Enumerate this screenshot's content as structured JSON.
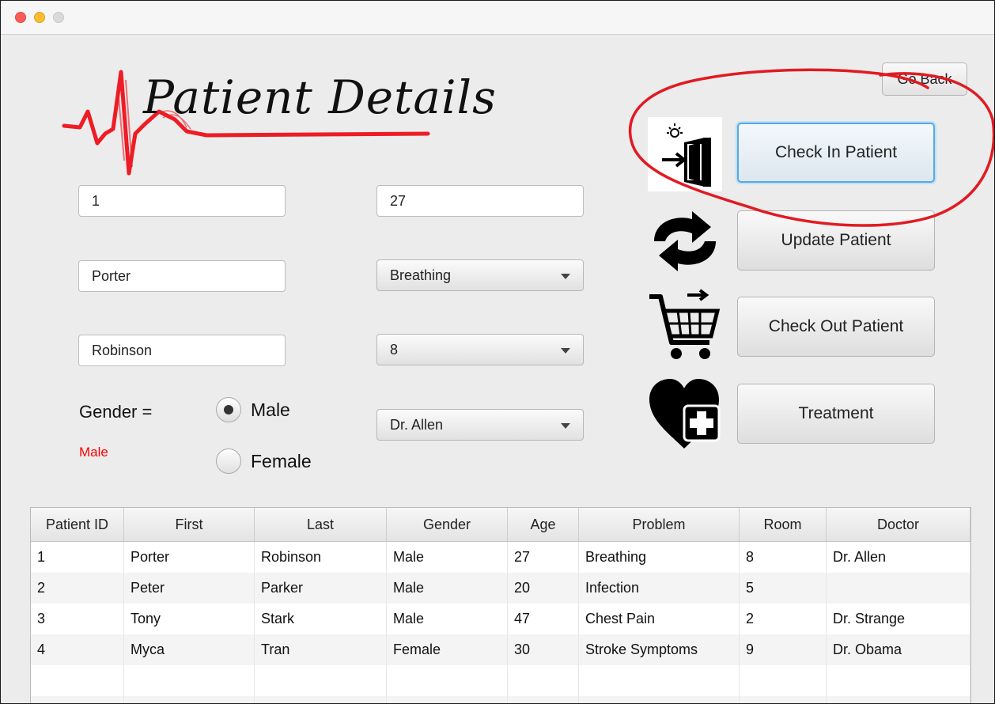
{
  "header": {
    "title": "Patient Details",
    "go_back_label": "Go Back"
  },
  "form": {
    "patient_id": "1",
    "age": "27",
    "first_name": "Porter",
    "problem": "Breathing",
    "last_name": "Robinson",
    "room": "8",
    "gender_label": "Gender =",
    "gender_value": "Male",
    "gender_options": [
      {
        "label": "Male",
        "selected": true
      },
      {
        "label": "Female",
        "selected": false
      }
    ],
    "doctor": "Dr. Allen"
  },
  "actions": [
    {
      "label": "Check In Patient",
      "icon": "check-in-door-icon",
      "focused": true
    },
    {
      "label": "Update Patient",
      "icon": "refresh-arrows-icon",
      "focused": false
    },
    {
      "label": "Check Out Patient",
      "icon": "shopping-cart-icon",
      "focused": false
    },
    {
      "label": "Treatment",
      "icon": "heart-plus-icon",
      "focused": false
    }
  ],
  "table": {
    "columns": [
      "Patient ID",
      "First",
      "Last",
      "Gender",
      "Age",
      "Problem",
      "Room",
      "Doctor"
    ],
    "rows": [
      [
        "1",
        "Porter",
        "Robinson",
        "Male",
        "27",
        "Breathing",
        "8",
        "Dr. Allen"
      ],
      [
        "2",
        "Peter",
        "Parker",
        "Male",
        "20",
        "Infection",
        "5",
        ""
      ],
      [
        "3",
        "Tony",
        "Stark",
        "Male",
        "47",
        "Chest Pain",
        "2",
        "Dr. Strange"
      ],
      [
        "4",
        "Myca",
        "Tran",
        "Female",
        "30",
        "Stroke Symptoms",
        "9",
        "Dr. Obama"
      ],
      [
        "",
        "",
        "",
        "",
        "",
        "",
        "",
        ""
      ],
      [
        "",
        "",
        "",
        "",
        "",
        "",
        "",
        ""
      ]
    ]
  },
  "colors": {
    "accent_red": "#ee1c25",
    "focus_blue": "#58a9e2",
    "gender_text": "#ff0000"
  }
}
